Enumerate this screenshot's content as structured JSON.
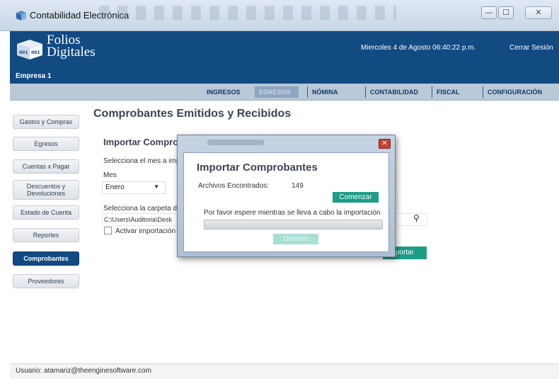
{
  "window": {
    "title": "Contabilidad Electrónica",
    "minimize": "—",
    "maximize": "☐",
    "close": "✕"
  },
  "header": {
    "logo_line1": "Folios",
    "logo_line2": "Digitales",
    "company": "Empresa 1",
    "datetime": "Miercoles 4 de Agosto 06:40:22 p.m.",
    "logout": "Cerrar Sesión"
  },
  "nav": {
    "items": [
      {
        "label": "INGRESOS"
      },
      {
        "label": "EGRESOS"
      },
      {
        "label": "NÓMINA"
      },
      {
        "label": "CONTABILIDAD"
      },
      {
        "label": "FISCAL"
      },
      {
        "label": "CONFIGURACIÓN"
      }
    ],
    "active": "EGRESOS"
  },
  "sidebar": {
    "items": [
      {
        "label": "Gastos y Compras"
      },
      {
        "label": "Egresos"
      },
      {
        "label": "Cuentas x Pagar"
      },
      {
        "label": "Descuentos y Devoluciones"
      },
      {
        "label": "Estado de Cuenta"
      },
      {
        "label": "Reportes"
      },
      {
        "label": "Comprobantes"
      },
      {
        "label": "Proveedores"
      }
    ],
    "active": "Comprobantes"
  },
  "main": {
    "page_title": "Comprobantes Emitidos y Recibidos",
    "section_title": "Importar Comprob",
    "month_prompt": "Selecciona el mes a impo",
    "month_label": "Mes",
    "month_value": "Enero",
    "folder_prompt": "Selecciona la carpeta do",
    "folder_path": "C:\\Users\\Auditoria\\Desk",
    "auto_import_label": "Activar importación a",
    "import_button": "portar"
  },
  "modal": {
    "heading": "Importar Comprobantes",
    "files_found_label": "Archivos Encontrados:",
    "files_found_value": "149",
    "start_button": "Comenzar",
    "wait_message": "Por favor espere mientras se lleva a cabo la importación",
    "progress": 0,
    "stop_button": "Detener",
    "close": "✕"
  },
  "status": {
    "user": "Usuario: atamariz@theenginesoftware.com"
  },
  "colors": {
    "header": "#124a82",
    "accent": "#1e9c86",
    "nav": "#b9c9d8"
  }
}
